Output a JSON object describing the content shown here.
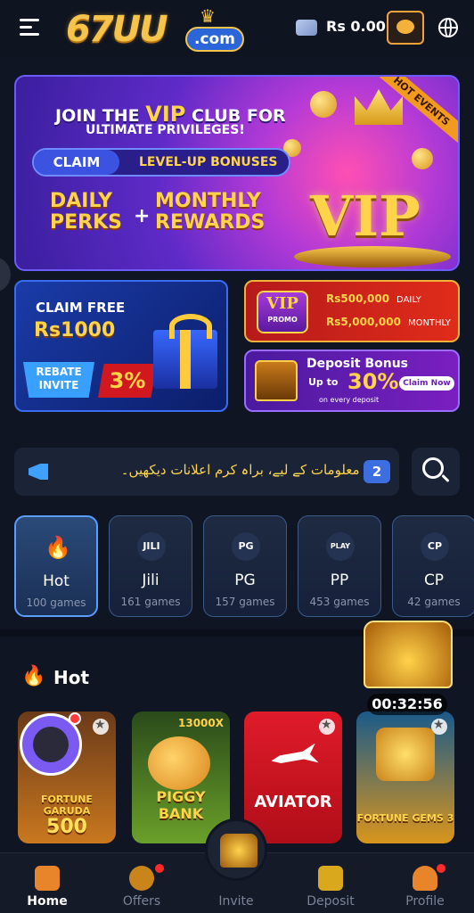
{
  "header": {
    "logo_text": "67UU",
    "logo_domain": ".com",
    "balance": "Rs 0.00"
  },
  "banners": {
    "main": {
      "line1_pre": "JOIN THE ",
      "line1_vip": "VIP",
      "line1_post": " CLUB FOR",
      "line2": "ULTIMATE PRIVILEGES!",
      "claim": "CLAIM",
      "levelup": "LEVEL-UP BONUSES",
      "daily": "DAILY",
      "perks": "PERKS",
      "monthly": "MONTHLY",
      "rewards": "REWARDS",
      "plus": "+",
      "vip_big": "VIP",
      "hot_events": "HOT EVENTS"
    },
    "claim_free": {
      "line1": "CLAIM FREE",
      "amount": "Rs1000",
      "rebate": "REBATE",
      "invite": "INVITE",
      "percent": "3%"
    },
    "vip_promo": {
      "badge": "VIP",
      "badge_sub": "PROMO",
      "daily_amount": "Rs500,000",
      "daily_label": "DAILY",
      "monthly_amount": "Rs5,000,000",
      "monthly_label": "MONTHLY"
    },
    "deposit_bonus": {
      "title": "Deposit Bonus",
      "upto": "Up to",
      "percent": "30%",
      "every": "on every deposit",
      "claim_now": "Claim Now"
    }
  },
  "notice": {
    "text": "کی معلومات کے لیے، براہ کرم اعلانات دیکھیں۔",
    "count": "2"
  },
  "categories": [
    {
      "name": "Hot",
      "count": "100 games",
      "icon": "flame-icon",
      "badge": ""
    },
    {
      "name": "Jili",
      "count": "161 games",
      "icon": "jili-icon",
      "badge": "JILI"
    },
    {
      "name": "PG",
      "count": "157 games",
      "icon": "pg-icon",
      "badge": "PG"
    },
    {
      "name": "PP",
      "count": "453 games",
      "icon": "pp-icon",
      "badge": "PLAY"
    },
    {
      "name": "CP",
      "count": "42 games",
      "icon": "cp-icon",
      "badge": "CP"
    }
  ],
  "hot_section": {
    "title": "Hot",
    "timer": "00:32:56"
  },
  "games": [
    {
      "title": "FORTUNE GARUDA",
      "subtitle": "500"
    },
    {
      "title": "PIGGY BANK",
      "subtitle": "",
      "tag": "13000X"
    },
    {
      "title": "AVIATOR",
      "subtitle": ""
    },
    {
      "title": "FORTUNE GEMS 3",
      "subtitle": ""
    }
  ],
  "bottom_nav": [
    {
      "label": "Home",
      "active": true
    },
    {
      "label": "Offers",
      "active": false
    },
    {
      "label": "Invite",
      "active": false
    },
    {
      "label": "Deposit",
      "active": false
    },
    {
      "label": "Profile",
      "active": false
    }
  ],
  "colors": {
    "accent_gold": "#ffd34a",
    "accent_blue": "#3d6ee0",
    "background": "#0f1522",
    "alert_red": "#ff2a2a"
  }
}
